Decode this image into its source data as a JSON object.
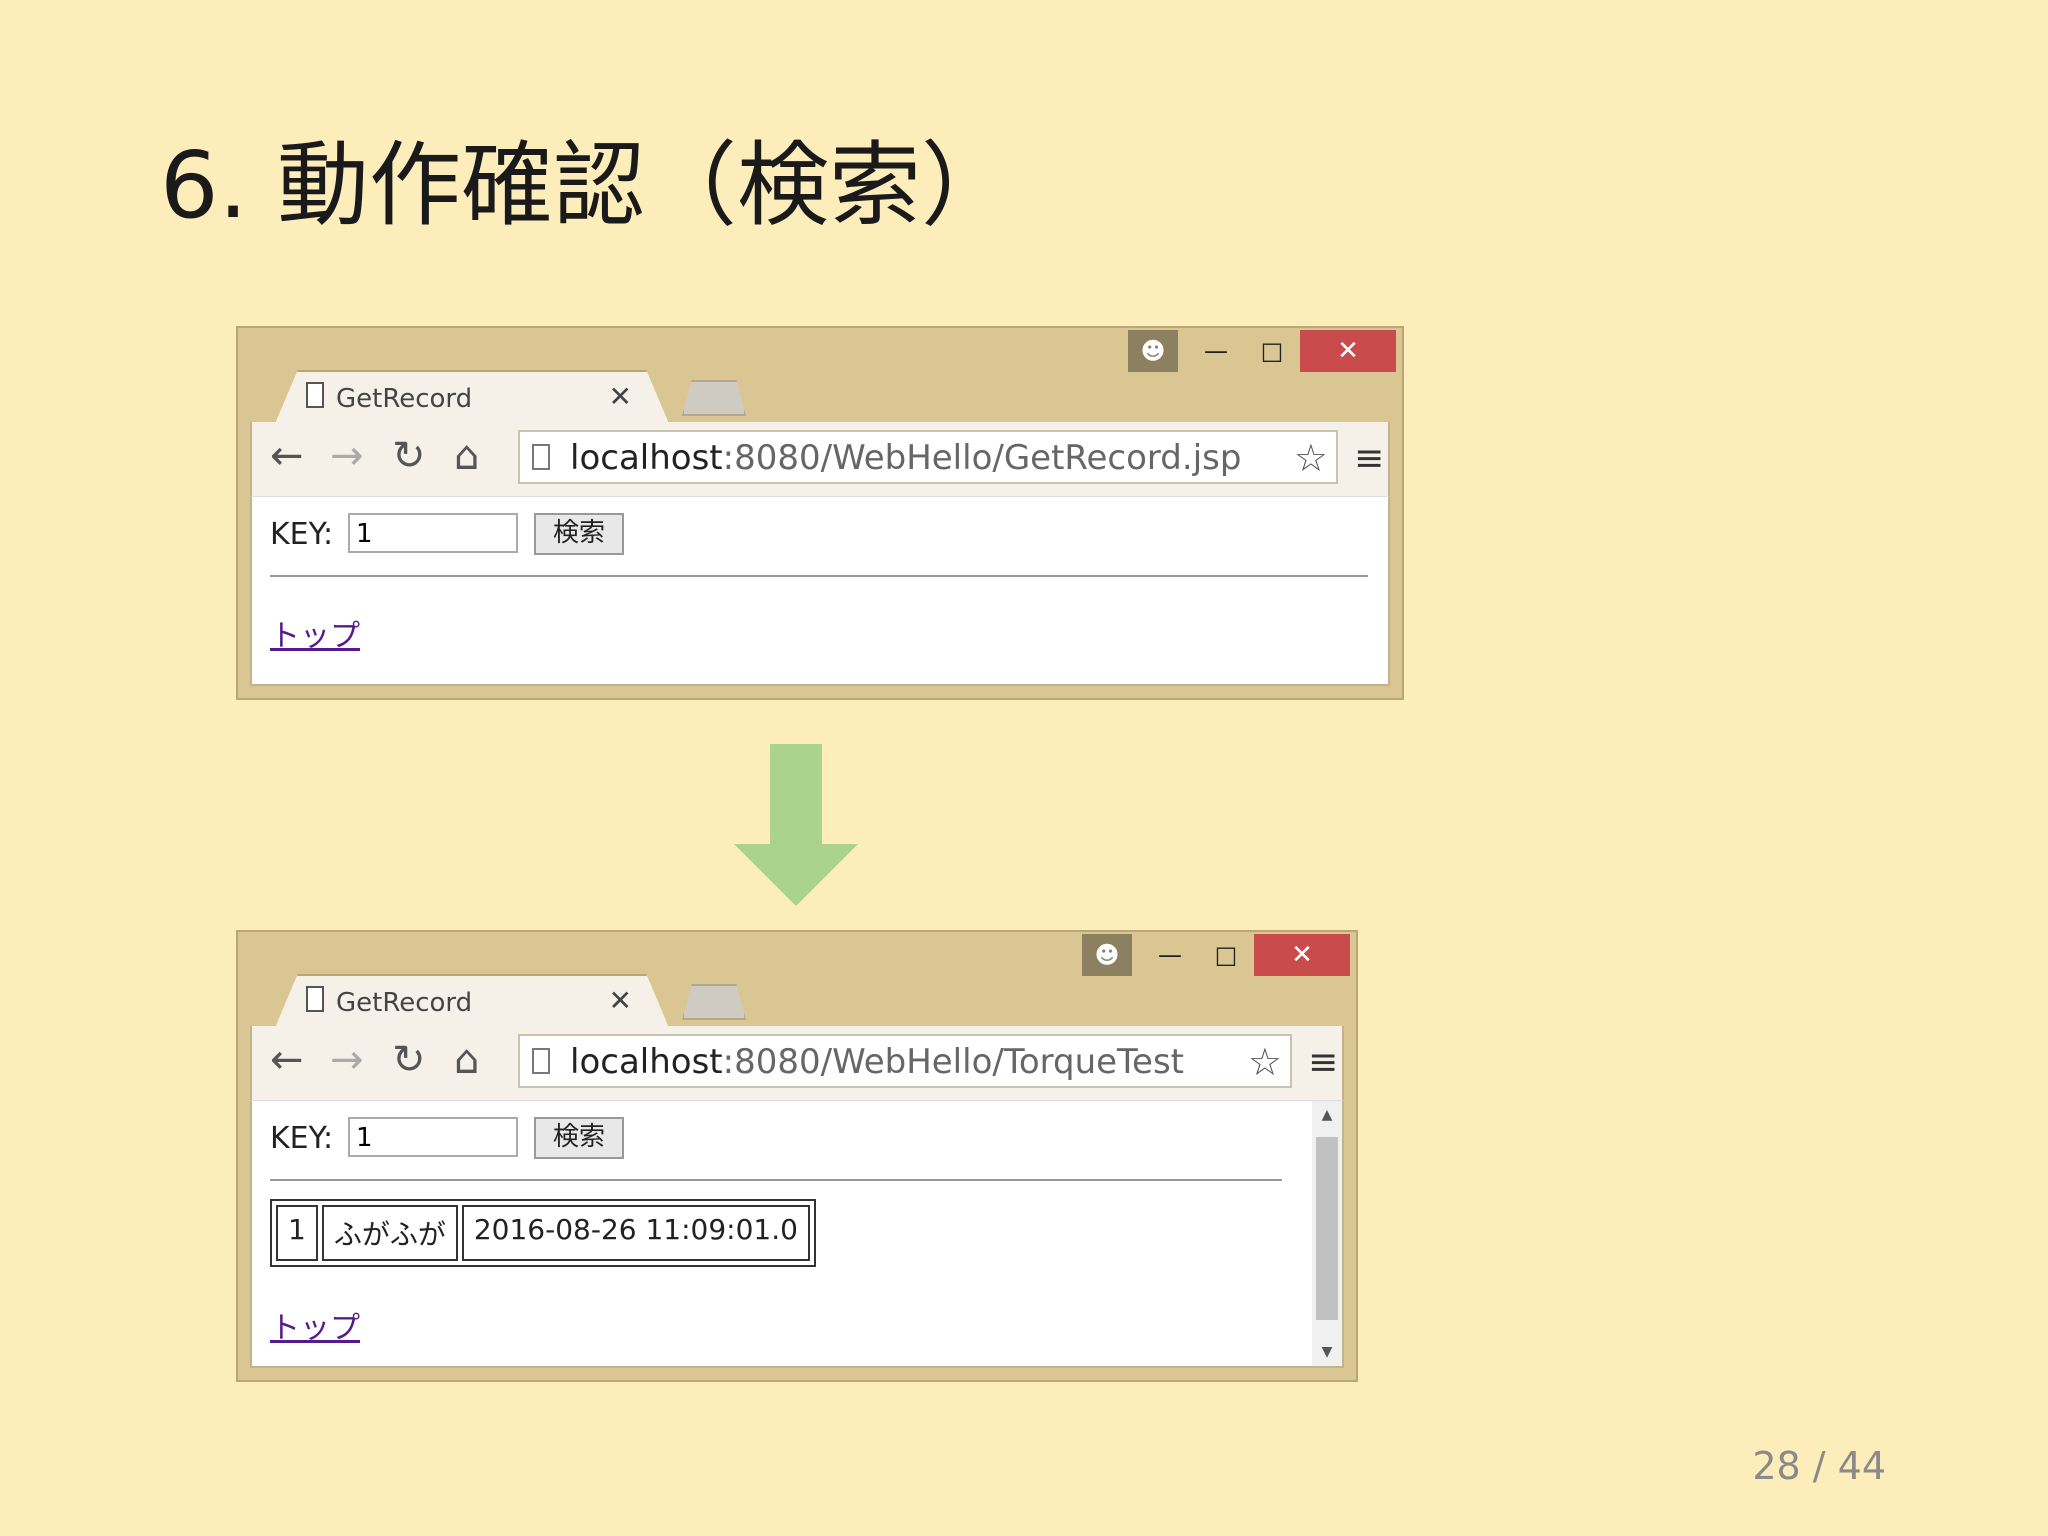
{
  "slide": {
    "title": "6. 動作確認（検索）",
    "page_number": "28 / 44"
  },
  "browser1": {
    "tab_title": "GetRecord",
    "url_host": "localhost",
    "url_rest": ":8080/WebHello/GetRecord.jsp",
    "key_label": "KEY:",
    "key_value": "1",
    "search_button": "検索",
    "top_link": "トップ"
  },
  "browser2": {
    "tab_title": "GetRecord",
    "url_host": "localhost",
    "url_rest": ":8080/WebHello/TorqueTest",
    "key_label": "KEY:",
    "key_value": "1",
    "search_button": "検索",
    "result_row": [
      "1",
      "ふがふが",
      "2016-08-26 11:09:01.0"
    ],
    "top_link": "トップ"
  },
  "colors": {
    "background": "#fdedbb",
    "window_frame": "#d9c692",
    "close_button": "#c94b4b",
    "arrow": "#aad38e"
  },
  "icons": [
    "page-icon",
    "close-icon",
    "back-arrow-icon",
    "forward-arrow-icon",
    "reload-icon",
    "home-icon",
    "star-icon",
    "menu-icon",
    "user-icon",
    "minimize-icon",
    "maximize-icon",
    "down-arrow-icon"
  ]
}
